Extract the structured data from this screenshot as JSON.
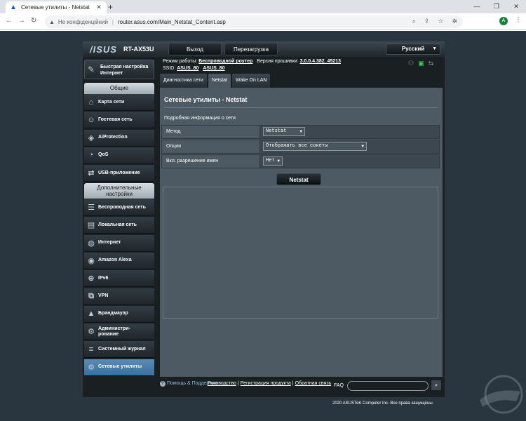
{
  "browser": {
    "tab_title": "Сетевые утилиты - Netstat",
    "tab_close": "✕",
    "new_tab": "+",
    "security_label": "Не конфіденційний",
    "url": "router.asus.com/Main_Netstat_Content.asp",
    "profile_initial": "A"
  },
  "router": {
    "brand": "/ISUS",
    "model": "RT-AX53U",
    "logout_label": "Выход",
    "reboot_label": "Перезагрузка",
    "language": "Русский"
  },
  "status": {
    "mode_label": "Режим работы:",
    "mode_value": "Беспроводной роутер",
    "firmware_label": "Версия прошивки:",
    "firmware_value": "3.0.0.4.382_45213",
    "ssid_label": "SSID:",
    "ssid_1": "ASUS_80",
    "ssid_2": "ASUS_80"
  },
  "sidebar": {
    "quick_setup": "Быстрая настройка Интернет",
    "general_header": "Общие",
    "general_items": [
      {
        "label": "Карта сети",
        "icon": "network-map-icon"
      },
      {
        "label": "Гостевая сеть",
        "icon": "guest-network-icon"
      },
      {
        "label": "AiProtection",
        "icon": "aiprotection-icon"
      },
      {
        "label": "QoS",
        "icon": "qos-icon"
      },
      {
        "label": "USB-приложение",
        "icon": "usb-icon"
      }
    ],
    "advanced_header": "Дополнительные настройки",
    "advanced_items": [
      {
        "label": "Беспроводная сеть",
        "icon": "wireless-icon"
      },
      {
        "label": "Локальная сеть",
        "icon": "lan-icon"
      },
      {
        "label": "Интернет",
        "icon": "globe-icon"
      },
      {
        "label": "Amazon Alexa",
        "icon": "alexa-icon"
      },
      {
        "label": "IPv6",
        "icon": "ipv6-icon"
      },
      {
        "label": "VPN",
        "icon": "vpn-icon"
      },
      {
        "label": "Брандмауэр",
        "icon": "firewall-icon"
      },
      {
        "label": "Администри-\nрование",
        "icon": "admin-icon"
      },
      {
        "label": "Системный журнал",
        "icon": "log-icon"
      },
      {
        "label": "Сетевые утилиты",
        "icon": "network-tools-icon"
      }
    ]
  },
  "content": {
    "tabs": [
      "Диагностика сети",
      "Netstat",
      "Wake On LAN"
    ],
    "active_tab": 1,
    "title": "Сетевые утилиты - Netstat",
    "description": "Подробная информация о сети",
    "fields": [
      {
        "label": "Метод",
        "value": "Netstat"
      },
      {
        "label": "Опции",
        "value": "Отображать все сокеты"
      },
      {
        "label": "Вкл. разрешение имен",
        "value": "Нет"
      }
    ],
    "button_label": "Netstat"
  },
  "footer": {
    "help_label": "Помощь & Поддержка",
    "manual": "Руководство",
    "registration": "Регистрация продукта",
    "feedback": "Обратная связь",
    "faq": "FAQ",
    "copyright": "2020 ASUSTeK Computer Inc. Все права защищены."
  },
  "colors": {
    "page_bg": "#293640",
    "content_bg": "#4d5a63",
    "active_menu": "#4a7eab",
    "link": "#8fb8e3"
  }
}
